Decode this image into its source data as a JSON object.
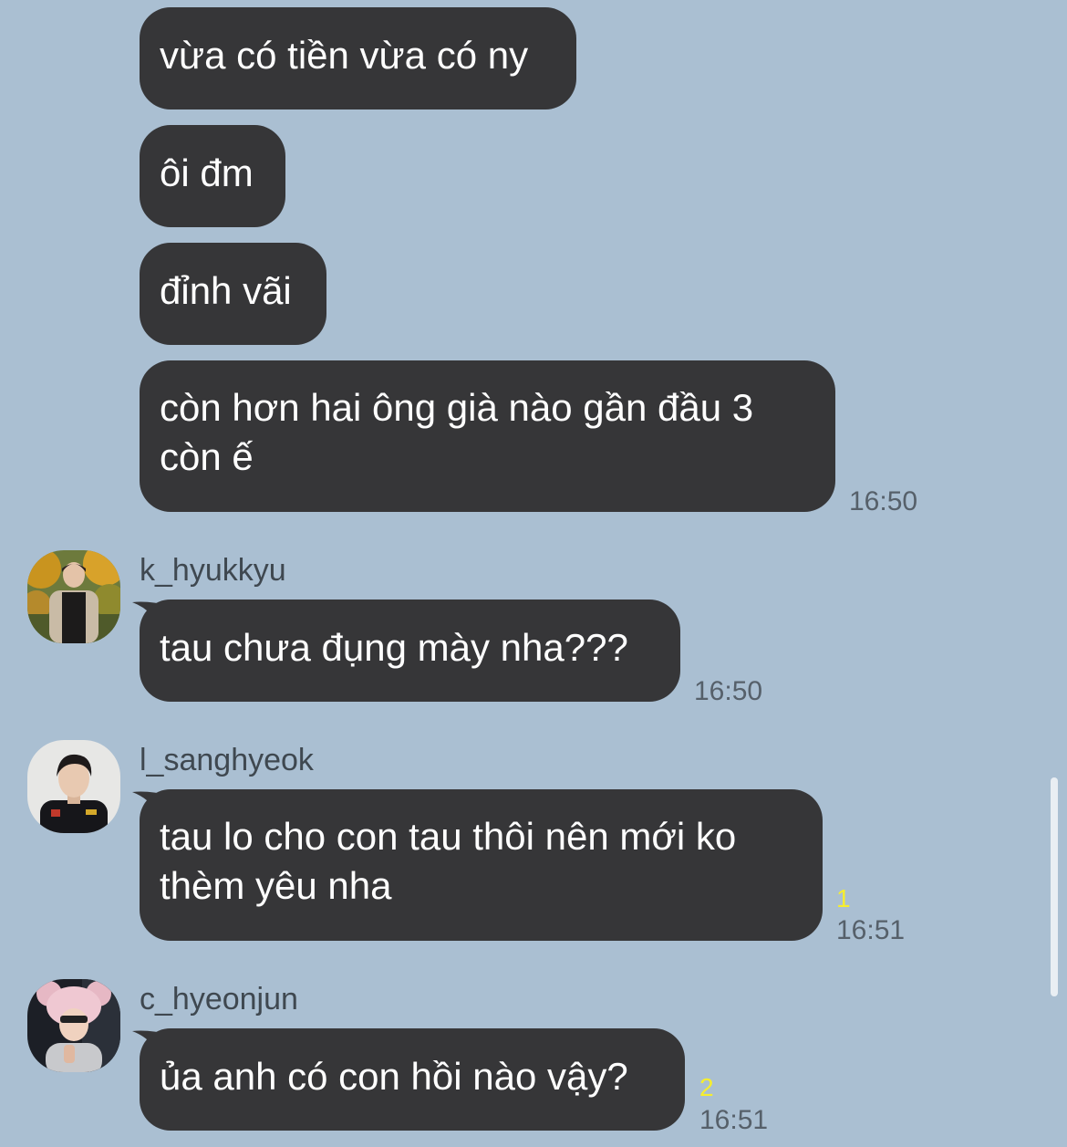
{
  "messages": [
    {
      "text": "vừa có tiền vừa có ny"
    },
    {
      "text": "ôi đm"
    },
    {
      "text": "đỉnh vãi"
    },
    {
      "line1": "còn hơn hai ông già nào gần đầu 3",
      "line2": "còn ế",
      "time": "16:50"
    },
    {
      "username": "k_hyukkyu",
      "text": "tau chưa đụng mày nha???",
      "time": "16:50"
    },
    {
      "username": "l_sanghyeok",
      "line1": "tau lo cho con tau thôi nên mới ko",
      "line2": "thèm yêu nha",
      "unread": "1",
      "time": "16:51"
    },
    {
      "username": "c_hyeonjun",
      "text": "ủa anh có con hồi nào vậy?",
      "unread": "2",
      "time": "16:51"
    }
  ],
  "colors": {
    "background": "#aabfd2",
    "bubble": "#363638",
    "bubble_text": "#ffffff",
    "timestamp": "#56606a",
    "unread_count": "#f6ee2e",
    "username": "#3f4850"
  }
}
